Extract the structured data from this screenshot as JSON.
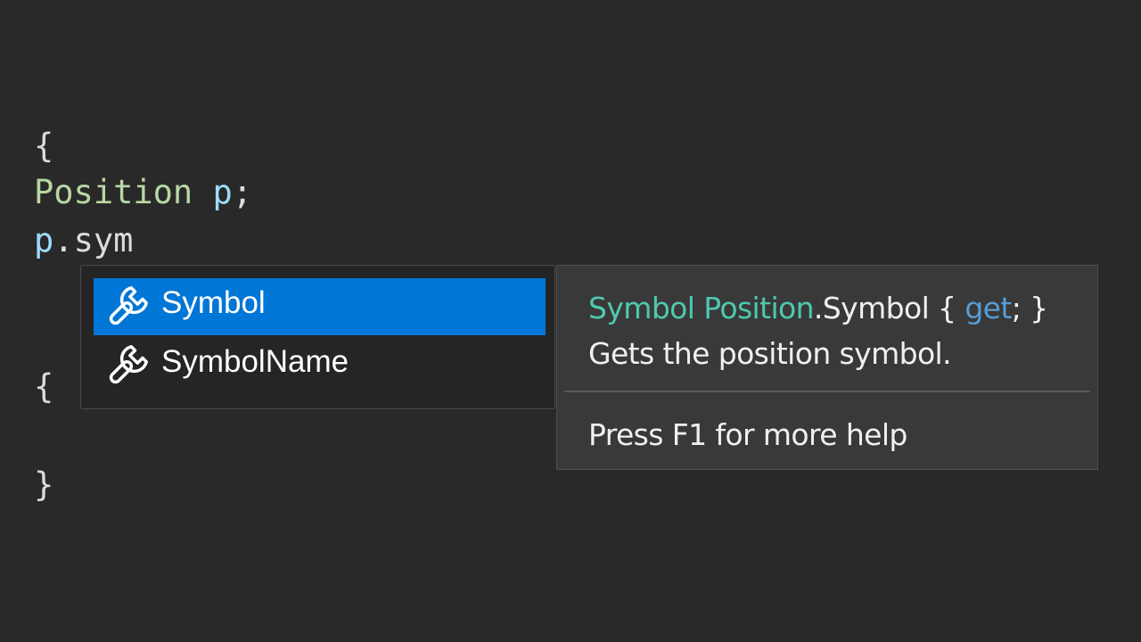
{
  "code": {
    "line1": {
      "open_brace": "{"
    },
    "line2": {
      "type": "Position",
      "space": " ",
      "variable": "p",
      "semicolon": ";"
    },
    "line3": {
      "object": "p",
      "dot": ".",
      "member": "sym"
    },
    "line4": {
      "open_brace": "{"
    },
    "line5": {
      "close_brace": "}"
    }
  },
  "completion": {
    "selected_index": 0,
    "items": [
      {
        "label": "Symbol",
        "icon": "wrench-icon",
        "selected": true
      },
      {
        "label": "SymbolName",
        "icon": "wrench-icon",
        "selected": false
      }
    ]
  },
  "quick_info": {
    "signature": {
      "return_type": "Symbol",
      "space": " ",
      "container_type": "Position",
      "member": ".Symbol { ",
      "accessor": "get",
      "tail": "; }"
    },
    "description": "Gets the position symbol.",
    "help": "Press F1 for more help"
  },
  "colors": {
    "background": "#292929",
    "selection": "#0076d6",
    "type_color": "#b8d7a3",
    "variable_color": "#9cdcfe",
    "signature_type": "#4ec9b0",
    "keyword": "#569cd6"
  }
}
